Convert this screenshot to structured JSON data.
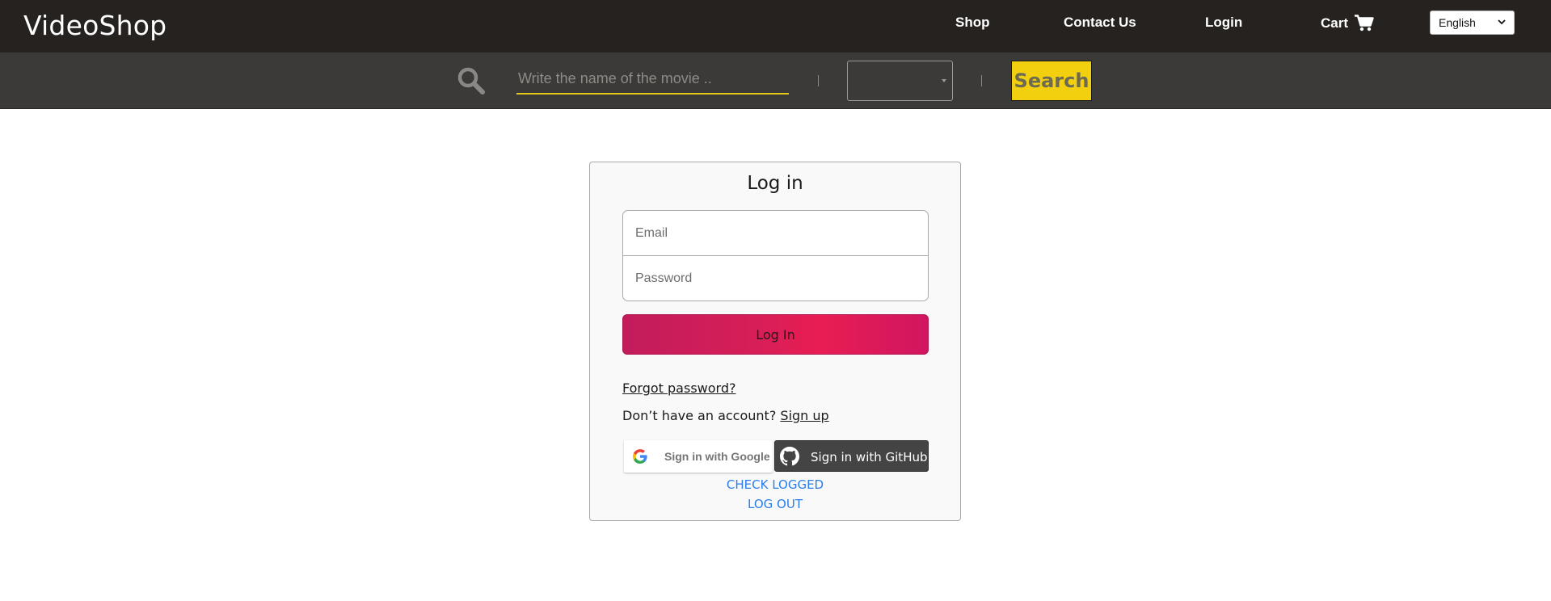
{
  "navbar": {
    "brand": "VideoShop",
    "links": {
      "shop": "Shop",
      "contact": "Contact Us",
      "login": "Login",
      "cart": "Cart"
    },
    "language": "English"
  },
  "search": {
    "placeholder": "Write the name of the movie ..",
    "genre_value": "",
    "button_label": "Search",
    "accent_color": "#f2d00f"
  },
  "login_card": {
    "title": "Log in",
    "email_placeholder": "Email",
    "password_placeholder": "Password",
    "login_button": "Log In",
    "forgot_password": "Forgot password?",
    "no_account_text": "Don’t have an account?",
    "signup_link": "Sign up",
    "google_button": "Sign in with Google",
    "github_button": "Sign in with GitHub",
    "check_logged": "CHECK LOGGED",
    "log_out": "LOG OUT"
  },
  "colors": {
    "navbar_bg": "#262220",
    "searchbar_bg": "#3b3a38",
    "login_gradient": [
      "#c21c5c",
      "#e81d53"
    ],
    "link_blue": "#2b7de9"
  },
  "icons": {
    "search": "search-icon",
    "cart": "cart-icon",
    "google": "google-logo-icon",
    "github": "github-logo-icon",
    "select_chevron": "chevron-down-icon"
  }
}
